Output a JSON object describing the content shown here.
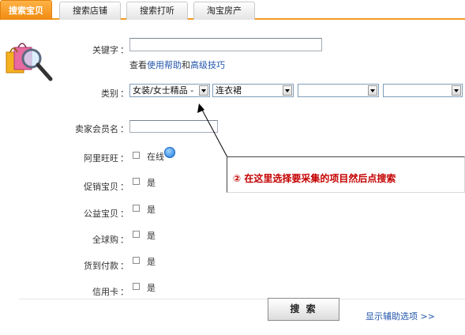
{
  "tabs": [
    {
      "label": "搜索宝贝",
      "active": true
    },
    {
      "label": "搜索店铺",
      "active": false
    },
    {
      "label": "搜索打听",
      "active": false
    },
    {
      "label": "淘宝房产",
      "active": false
    }
  ],
  "form": {
    "keyword_label": "关键字",
    "keyword_value": "",
    "help_prefix": "查看",
    "help_link": "使用帮助",
    "help_and": "和",
    "advanced_link": "高级技巧",
    "category_label": "类别",
    "category_selects": [
      "女装/女士精品 -",
      "连衣裙",
      "",
      ""
    ],
    "seller_label": "卖家会员名",
    "seller_value": "",
    "aliwangwang_label": "阿里旺旺",
    "online_label": "在线",
    "promo_label": "促销宝贝",
    "charity_label": "公益宝贝",
    "global_label": "全球购",
    "cod_label": "货到付款",
    "credit_label": "信用卡",
    "yes_label": "是",
    "colon": "："
  },
  "callout": {
    "text": "② 在这里选择要采集的项目然后点搜索",
    "color": "#c40000"
  },
  "actions": {
    "search_label": "搜 索",
    "more_options": "显示辅助选项 >>"
  },
  "colors": {
    "accent": "#f08a10",
    "link": "#2255aa"
  }
}
